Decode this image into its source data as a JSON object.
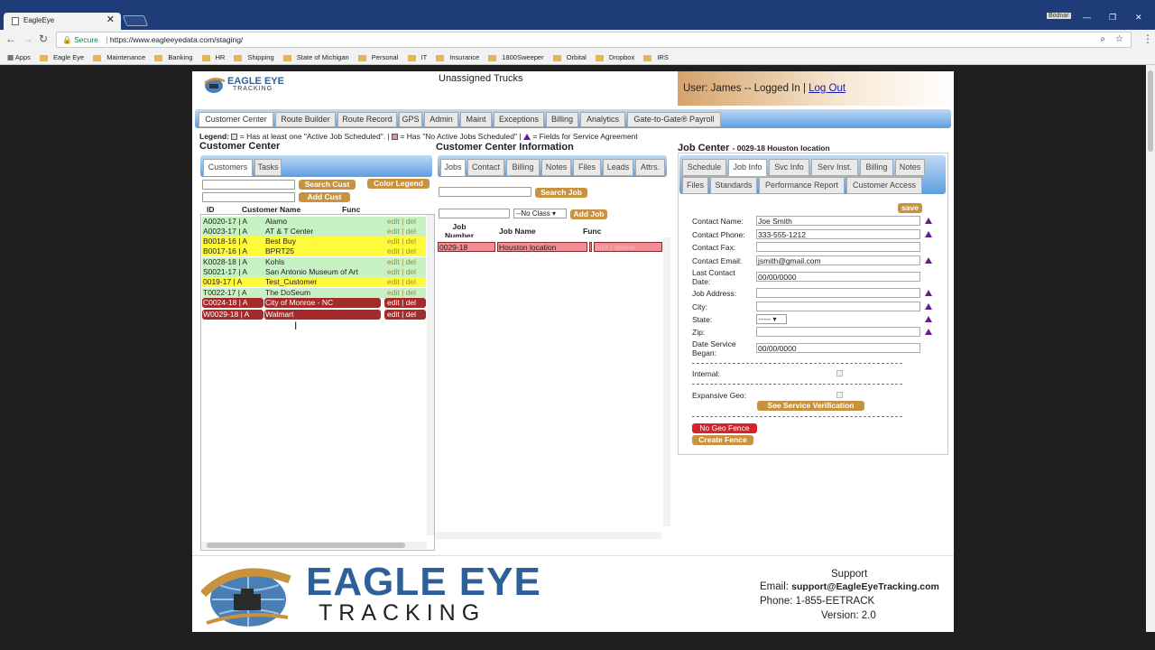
{
  "browser": {
    "tab_title": "EagleEye",
    "close": "✕",
    "user_badge": "Bodnar",
    "url_secure": "Secure",
    "url": "https://www.eagleeyedata.com/staging/",
    "bookmarks": [
      "Apps",
      "Eagle Eye",
      "Maintenance",
      "Banking",
      "HR",
      "Shipping",
      "State of Michigan",
      "Personal",
      "IT",
      "Insurance",
      "1800Sweeper",
      "Orbital",
      "Dropbox",
      "IRS"
    ]
  },
  "header": {
    "logo_small_top": "EAGLE EYE",
    "logo_small_bottom": "TRACKING",
    "page_title": "Unassigned Trucks",
    "user_text": "User: James -- Logged In |",
    "logout": "Log Out"
  },
  "main_nav": [
    "Customer Center",
    "Route Builder",
    "Route Record",
    "GPS",
    "Admin",
    "Maint",
    "Exceptions",
    "Billing",
    "Analytics",
    "Gate-to-Gate® Payroll"
  ],
  "legend": {
    "label": "Legend:",
    "item1": "= Has at least one \"Active Job Scheduled\". |",
    "item2": "= Has \"No Active Jobs Scheduled\" |",
    "item3": "= Fields for Service Agreement",
    "green": "#c6f2c4",
    "red": "#f08e95",
    "purple": "#6a1b8a"
  },
  "customer_center": {
    "title": "Customer Center",
    "tabs": [
      "Customers",
      "Tasks"
    ],
    "search_btn": "Search Cust",
    "add_btn": "Add Cust",
    "legend_btn": "Color Legend",
    "col_id": "ID",
    "col_name": "Customer Name",
    "col_func": "Func",
    "rows": [
      {
        "id": "A0020-17 | A",
        "name": "Alamo",
        "func": "edit | del",
        "color": "green"
      },
      {
        "id": "A0023-17 | A",
        "name": "AT & T Center",
        "func": "edit | del",
        "color": "green"
      },
      {
        "id": "B0018-16 | A",
        "name": "Best Buy",
        "func": "edit | del",
        "color": "yellow"
      },
      {
        "id": "B0017-16 | A",
        "name": "BPRT25",
        "func": "edit | del",
        "color": "yellow"
      },
      {
        "id": "K0028-18 | A",
        "name": "Kohls",
        "func": "edit | del",
        "color": "green"
      },
      {
        "id": "S0021-17 | A",
        "name": "San Antonio Museum of Art",
        "func": "edit | del",
        "color": "green"
      },
      {
        "id": "0019-17 | A",
        "name": "Test_Customer",
        "func": "edit | del",
        "color": "yellow"
      },
      {
        "id": "T0022-17 | A",
        "name": "The DoSeum",
        "func": "edit | del",
        "color": "green"
      },
      {
        "id": "C0024-18 | A",
        "name": "City of Monroe - NC",
        "func": "edit | del",
        "color": "red"
      },
      {
        "id": "W0029-18 | A",
        "name": "Walmart",
        "func": "edit | del",
        "color": "red"
      }
    ]
  },
  "info_center": {
    "title": "Customer Center Information",
    "tabs": [
      "Jobs",
      "Contact",
      "Billing",
      "Notes",
      "Files",
      "Leads",
      "Attrs."
    ],
    "search_btn": "Search Job",
    "class_select": "--No Class",
    "add_btn": "Add Job",
    "col_num": "Job Number",
    "col_name": "Job Name",
    "col_func": "Func",
    "job_row": {
      "num": "0029-18",
      "name": "Houston location",
      "func": "edit | delete"
    }
  },
  "job_center": {
    "title": "Job Center",
    "subtitle": "- 0029-18 Houston location",
    "tabs_row1": [
      "Schedule",
      "Job Info",
      "Svc Info",
      "Serv Inst.",
      "Billing",
      "Notes"
    ],
    "tabs_row2": [
      "Files",
      "Standards",
      "Performance Report",
      "Customer Access"
    ],
    "save": "save",
    "fields": {
      "contact_name_label": "Contact Name:",
      "contact_name": "Joe Smith",
      "contact_phone_label": "Contact Phone:",
      "contact_phone": "333-555-1212",
      "contact_fax_label": "Contact Fax:",
      "contact_fax": "",
      "contact_email_label": "Contact Email:",
      "contact_email": "jsmith@gmail.com",
      "last_contact_label": "Last Contact Date:",
      "last_contact": "00/00/0000",
      "job_address_label": "Job Address:",
      "job_address": "",
      "city_label": "City:",
      "city": "",
      "state_label": "State:",
      "state": "-----",
      "zip_label": "Zip:",
      "zip": "",
      "date_began_label": "Date Service Began:",
      "date_began": "00/00/0000",
      "internal_label": "Internal:",
      "expansive_label": "Expansive Geo:"
    },
    "see_service_btn": "See Service Verification",
    "no_geo_btn": "No Geo Fence",
    "create_fence_btn": "Create Fence"
  },
  "footer": {
    "logo_top": "EAGLE EYE",
    "logo_bottom": "TRACKING",
    "support": "Support",
    "email_label": "Email:",
    "email": "support@EagleEyeTracking.com",
    "phone": "Phone: 1-855-EETRACK",
    "version": "Version: 2.0"
  }
}
